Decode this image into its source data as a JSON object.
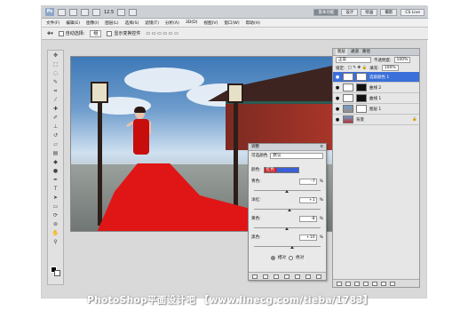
{
  "app": {
    "logo": "Ps",
    "zoom": "12.5",
    "workspaces": [
      "基本功能",
      "设计",
      "绘画",
      "摄影"
    ],
    "cs_live": "CS Live"
  },
  "menu": [
    "文件(F)",
    "编辑(E)",
    "图像(I)",
    "图层(L)",
    "选择(S)",
    "滤镜(T)",
    "分析(A)",
    "3D(D)",
    "视图(V)",
    "窗口(W)",
    "帮助(H)"
  ],
  "options": {
    "auto_select_label": "自动选择:",
    "auto_select_value": "组",
    "show_transform_label": "显示变换控件"
  },
  "dialog": {
    "title": "调整",
    "preset_label": "可选颜色",
    "preset_value": "默认",
    "colors_label": "颜色:",
    "colors_value": "红色",
    "rows": [
      {
        "label": "青色:",
        "value": "-7",
        "unit": "%",
        "knob": 0.47
      },
      {
        "label": "洋红:",
        "value": "+1",
        "unit": "%",
        "knob": 0.51
      },
      {
        "label": "黄色:",
        "value": "-8",
        "unit": "%",
        "knob": 0.46
      },
      {
        "label": "黑色:",
        "value": "+10",
        "unit": "%",
        "knob": 0.55
      }
    ],
    "mode_relative": "相对",
    "mode_absolute": "绝对"
  },
  "layers_panel": {
    "tabs": [
      "图层",
      "通道",
      "路径"
    ],
    "blend_mode": "正常",
    "opacity_label": "不透明度:",
    "opacity": "100%",
    "lock_label": "锁定:",
    "fill_label": "填充:",
    "fill": "100%",
    "layers": [
      {
        "name": "选取颜色 1",
        "selected": true
      },
      {
        "name": "曲线 2",
        "selected": false
      },
      {
        "name": "曲线 1",
        "selected": false
      },
      {
        "name": "图层 1",
        "selected": false
      },
      {
        "name": "背景",
        "selected": false
      }
    ]
  },
  "watermark": "PhotoShop平面设计吧 【www.linecg.com/tieba/1783】"
}
